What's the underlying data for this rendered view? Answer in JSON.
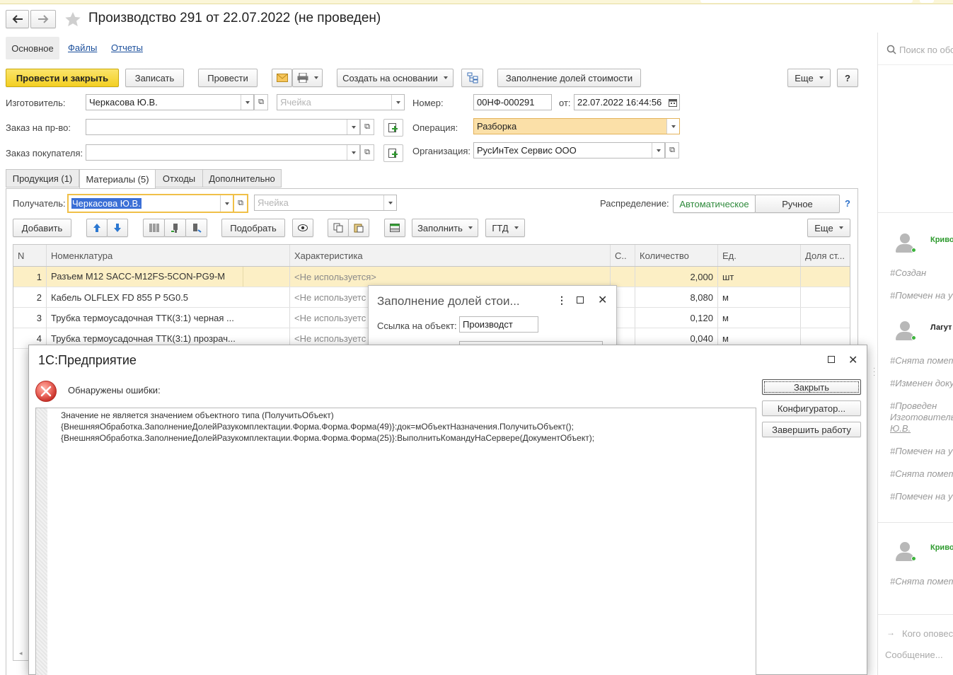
{
  "window": {
    "title": "Производство 291 от 22.07.2022 (не проведен)"
  },
  "nav_tabs": [
    "Основное",
    "Файлы",
    "Отчеты"
  ],
  "toolbar": {
    "post_close": "Провести и закрыть",
    "save": "Записать",
    "post": "Провести",
    "create_based": "Создать на основании",
    "fill_shares": "Заполнение долей стоимости",
    "more": "Еще",
    "help": "?"
  },
  "header_fields": {
    "manufacturer_label": "Изготовитель:",
    "manufacturer_value": "Черкасова Ю.В.",
    "cell_placeholder": "Ячейка",
    "number_label": "Номер:",
    "number_value": "00НФ-000291",
    "date_label": "от:",
    "date_value": "22.07.2022 16:44:56",
    "order_label": "Заказ на пр-во:",
    "operation_label": "Операция:",
    "operation_value": "Разборка",
    "customer_order_label": "Заказ покупателя:",
    "org_label": "Организация:",
    "org_value": "РусИнТех Сервис ООО"
  },
  "doc_tabs": [
    "Продукция (1)",
    "Материалы (5)",
    "Отходы",
    "Дополнительно"
  ],
  "materials": {
    "recipient_label": "Получатель:",
    "recipient_value": "Черкасова Ю.В.",
    "cell_placeholder": "Ячейка",
    "distribution_label": "Распределение:",
    "distribution_auto": "Автоматическое",
    "distribution_manual": "Ручное",
    "help": "?",
    "add": "Добавить",
    "pick": "Подобрать",
    "fill": "Заполнить",
    "gtd": "ГТД",
    "more": "Еще"
  },
  "table": {
    "columns": [
      "N",
      "Номенклатура",
      "Характеристика",
      "С..",
      "Количество",
      "Ед.",
      "Доля ст..."
    ],
    "rows": [
      {
        "n": "1",
        "name": "Разъем M12 SACC-M12FS-5CON-PG9-M",
        "char": "<Не используется>",
        "c": "",
        "qty": "2,000",
        "unit": "шт",
        "share": ""
      },
      {
        "n": "2",
        "name": "Кабель OLFLEX FD 855 P 5G0.5",
        "char": "<Не используетс",
        "c": "",
        "qty": "8,080",
        "unit": "м",
        "share": ""
      },
      {
        "n": "3",
        "name": "Трубка термоусадочная ТТК(3:1) черная  ...",
        "char": "<Не используетс",
        "c": "",
        "qty": "0,120",
        "unit": "м",
        "share": ""
      },
      {
        "n": "4",
        "name": "Трубка термоусадочная ТТК(3:1) прозрач...",
        "char": "<Не используетс",
        "c": "",
        "qty": "0,040",
        "unit": "м",
        "share": ""
      }
    ]
  },
  "fill_dialog": {
    "title": "Заполнение долей стои...",
    "ref_label": "Ссылка на объект:",
    "ref_value": "Производст"
  },
  "error_dialog": {
    "title": "1С:Предприятие",
    "message": "Обнаружены ошибки:",
    "lines": [
      "Значение не является значением объектного типа (ПолучитьОбъект)",
      "{ВнешняяОбработка.ЗаполнениеДолейРазукомплектации.Форма.Форма.Форма(49)}:док=мОбъектНазначения.ПолучитьОбъект();",
      "{ВнешняяОбработка.ЗаполнениеДолейРазукомплектации.Форма.Форма.Форма(25)}:ВыполнитьКомандуНаСервере(ДокументОбъект);"
    ],
    "close": "Закрыть",
    "configurator": "Конфигуратор...",
    "finish": "Завершить работу"
  },
  "side_panel": {
    "search_placeholder": "Поиск по обс",
    "user1": "Криво",
    "user2": "Лагут",
    "user3": "Криво",
    "events": [
      "#Создан",
      "#Помечен на уд",
      "#Снята помет",
      "#Изменен доку",
      "#Проведен",
      "Изготовитель",
      "Ю.В.",
      "#Помечен на уд",
      "#Снята помет",
      "#Помечен на уд",
      "#Снята помет"
    ],
    "notify_placeholder": "Кого оповес",
    "message_placeholder": "Сообщение..."
  }
}
